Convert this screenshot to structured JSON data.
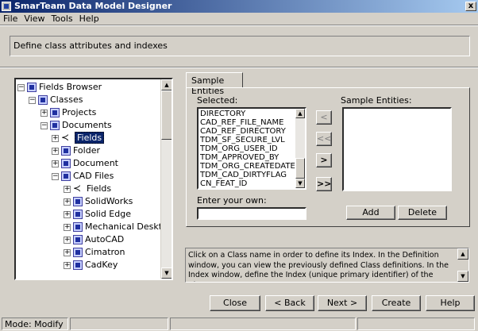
{
  "window": {
    "title": "SmarTeam Data Model Designer",
    "close_glyph": "x"
  },
  "menu": [
    {
      "label": "File"
    },
    {
      "label": "View"
    },
    {
      "label": "Tools"
    },
    {
      "label": "Help"
    }
  ],
  "header": {
    "instruction": "Define class attributes and indexes"
  },
  "tree": {
    "items": [
      {
        "label": "Fields Browser",
        "toggle": "−",
        "icon": "fields-browser-icon",
        "level": 0
      },
      {
        "label": "Classes",
        "toggle": "−",
        "icon": "class-icon",
        "level": 1
      },
      {
        "label": "Projects",
        "toggle": "+",
        "icon": "class-icon",
        "level": 2
      },
      {
        "label": "Documents",
        "toggle": "−",
        "icon": "class-icon",
        "level": 2
      },
      {
        "label": "Fields",
        "toggle": "+",
        "icon": "fields-icon",
        "level": 3,
        "selected": true
      },
      {
        "label": "Folder",
        "toggle": "+",
        "icon": "class-icon",
        "level": 3
      },
      {
        "label": "Document",
        "toggle": "+",
        "icon": "class-icon",
        "level": 3
      },
      {
        "label": "CAD Files",
        "toggle": "−",
        "icon": "class-icon",
        "level": 3
      },
      {
        "label": "Fields",
        "toggle": "+",
        "icon": "fields-icon",
        "level": 4
      },
      {
        "label": "SolidWorks",
        "toggle": "+",
        "icon": "class-icon",
        "level": 4
      },
      {
        "label": "Solid Edge",
        "toggle": "+",
        "icon": "class-icon",
        "level": 4
      },
      {
        "label": "Mechanical Desktop",
        "toggle": "+",
        "icon": "class-icon",
        "level": 4
      },
      {
        "label": "AutoCAD",
        "toggle": "+",
        "icon": "class-icon",
        "level": 4
      },
      {
        "label": "Cimatron",
        "toggle": "+",
        "icon": "class-icon",
        "level": 4
      },
      {
        "label": "CadKey",
        "toggle": "+",
        "icon": "class-icon",
        "level": 4
      }
    ]
  },
  "tab": {
    "label": "Sample Entities"
  },
  "selected": {
    "label": "Selected:",
    "items": [
      "DIRECTORY",
      "CAD_REF_FILE_NAME",
      "CAD_REF_DIRECTORY",
      "TDM_SF_SECURE_LVL",
      "TDM_ORG_USER_ID",
      "TDM_APPROVED_BY",
      "TDM_ORG_CREATEDATE",
      "TDM_CAD_DIRTYFLAG",
      "CN_FEAT_ID"
    ]
  },
  "sample_entities": {
    "label": "Sample Entities:",
    "items": []
  },
  "move_buttons": {
    "remove_one": "<",
    "remove_all": "<<",
    "add_one": ">",
    "add_all": ">>"
  },
  "own_entry": {
    "label": "Enter your own:",
    "value": ""
  },
  "entity_buttons": {
    "add": "Add",
    "delete": "Delete"
  },
  "info": {
    "text": "Click on a Class name in order to define its Index. In the Definition window, you can view the previously defined Class definitions. In the Index window, define the Index (unique primary identifier) of the Class."
  },
  "footer_buttons": {
    "close": "Close",
    "back": "< Back",
    "next": "Next >",
    "create": "Create",
    "help": "Help"
  },
  "status": {
    "mode": "Mode: Modify",
    "cell2": "",
    "cell3": "",
    "cell4": ""
  }
}
